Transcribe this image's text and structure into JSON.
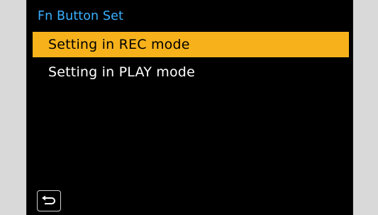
{
  "menu": {
    "title": "Fn Button Set",
    "items": [
      {
        "label": "Setting in REC mode",
        "selected": true
      },
      {
        "label": "Setting in PLAY mode",
        "selected": false
      }
    ]
  },
  "footer": {
    "back_icon": "return-arrow-icon"
  },
  "colors": {
    "title": "#3ab0ff",
    "highlight": "#f7b21b",
    "screen_bg": "#000000",
    "side_panels": "#d9d9d9"
  }
}
